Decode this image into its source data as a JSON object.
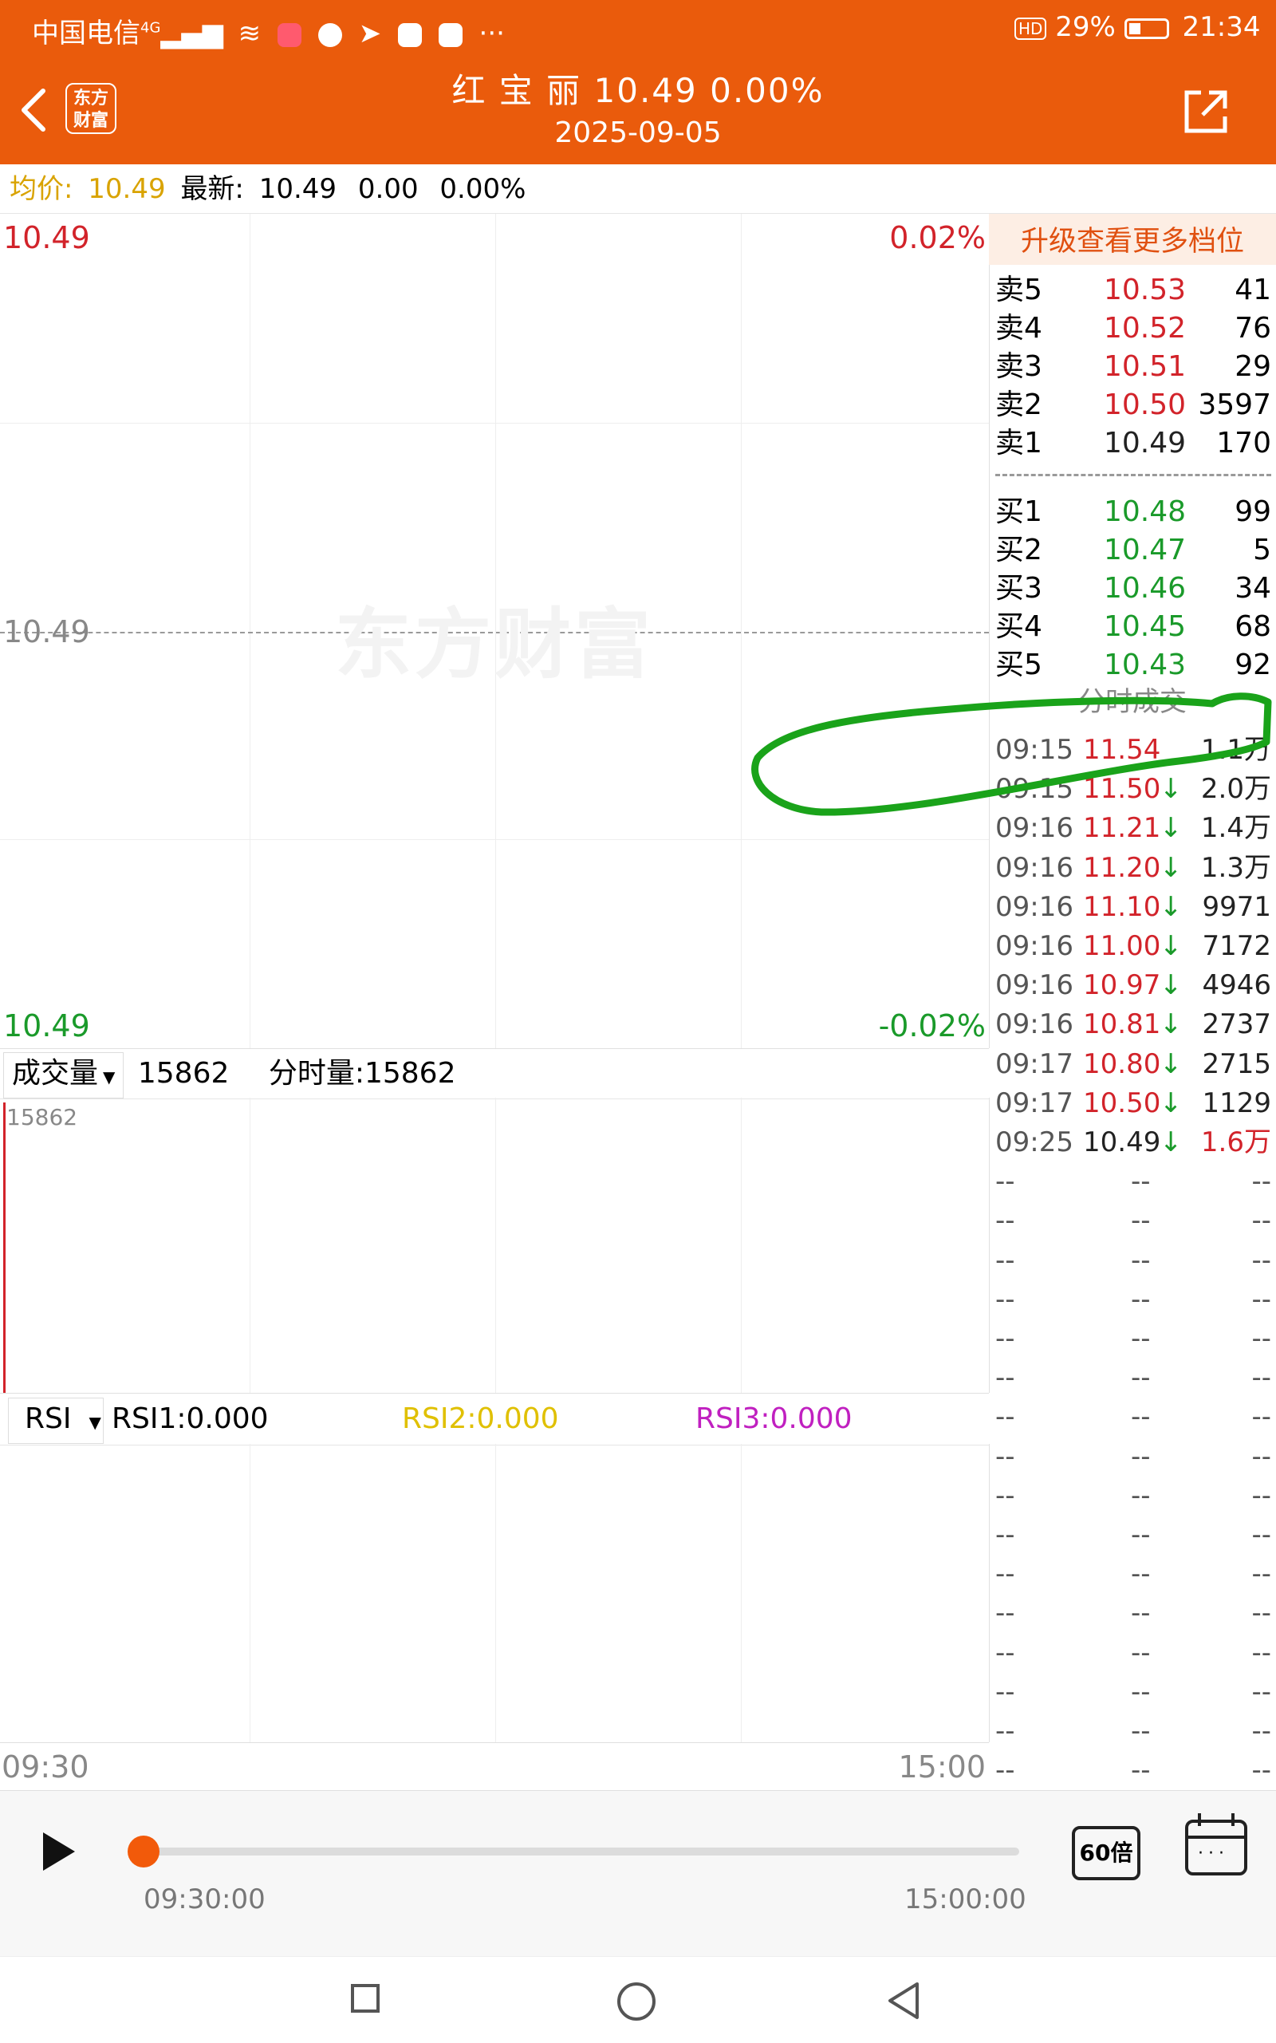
{
  "status_bar": {
    "carrier": "中国电信",
    "signal_type": "4G",
    "battery": "29%",
    "time": "21:34",
    "hd_badge": "HD"
  },
  "header": {
    "logo_text": [
      "东方",
      "财富"
    ],
    "title": "红 宝 丽  10.49  0.00%",
    "date": "2025-09-05"
  },
  "info": {
    "avg_label": "均价:",
    "avg_value": "10.49",
    "latest_label": "最新:",
    "latest_value": "10.49",
    "change": "0.00",
    "change_pct": "0.00%"
  },
  "chart": {
    "top_price": "10.49",
    "top_pct": "0.02%",
    "mid_price": "10.49",
    "bottom_price": "10.49",
    "bottom_pct": "-0.02%",
    "watermark": "东方财富",
    "time_start": "09:30",
    "time_end": "15:00"
  },
  "volume": {
    "selector": "成交量",
    "value": "15862",
    "fs_label": "分时量:15862",
    "axis_max": "15862"
  },
  "rsi": {
    "selector": "RSI",
    "rsi1": "RSI1:0.000",
    "rsi2": "RSI2:0.000",
    "rsi3": "RSI3:0.000"
  },
  "colors": {
    "brand": "#ea5b0c",
    "up": "#d2232a",
    "down": "#1a9a2a",
    "rsi2": "#e0c000",
    "rsi3": "#c020c0",
    "annotation": "#1aa31a"
  },
  "orderbook": {
    "upgrade": "升级查看更多档位",
    "asks": [
      {
        "label": "卖5",
        "price": "10.53",
        "vol": "41"
      },
      {
        "label": "卖4",
        "price": "10.52",
        "vol": "76"
      },
      {
        "label": "卖3",
        "price": "10.51",
        "vol": "29"
      },
      {
        "label": "卖2",
        "price": "10.50",
        "vol": "3597"
      },
      {
        "label": "卖1",
        "price": "10.49",
        "vol": "170"
      }
    ],
    "bids": [
      {
        "label": "买1",
        "price": "10.48",
        "vol": "99"
      },
      {
        "label": "买2",
        "price": "10.47",
        "vol": "5"
      },
      {
        "label": "买3",
        "price": "10.46",
        "vol": "34"
      },
      {
        "label": "买4",
        "price": "10.45",
        "vol": "68"
      },
      {
        "label": "买5",
        "price": "10.43",
        "vol": "92"
      }
    ]
  },
  "ticks": {
    "title": "分时成交",
    "rows": [
      {
        "time": "09:15",
        "price": "11.54",
        "arrow": "",
        "vol": "1.1万"
      },
      {
        "time": "09:15",
        "price": "11.50",
        "arrow": "↓",
        "vol": "2.0万"
      },
      {
        "time": "09:16",
        "price": "11.21",
        "arrow": "↓",
        "vol": "1.4万"
      },
      {
        "time": "09:16",
        "price": "11.20",
        "arrow": "↓",
        "vol": "1.3万"
      },
      {
        "time": "09:16",
        "price": "11.10",
        "arrow": "↓",
        "vol": "9971"
      },
      {
        "time": "09:16",
        "price": "11.00",
        "arrow": "↓",
        "vol": "7172"
      },
      {
        "time": "09:16",
        "price": "10.97",
        "arrow": "↓",
        "vol": "4946"
      },
      {
        "time": "09:16",
        "price": "10.81",
        "arrow": "↓",
        "vol": "2737"
      },
      {
        "time": "09:17",
        "price": "10.80",
        "arrow": "↓",
        "vol": "2715"
      },
      {
        "time": "09:17",
        "price": "10.50",
        "arrow": "↓",
        "vol": "1129"
      },
      {
        "time": "09:25",
        "price": "10.49",
        "arrow": "↓",
        "vol": "1.6万"
      }
    ],
    "empty_text": "--",
    "empty_count": 16
  },
  "player": {
    "start": "09:30:00",
    "end": "15:00:00",
    "speed": "60倍",
    "progress": 0
  }
}
